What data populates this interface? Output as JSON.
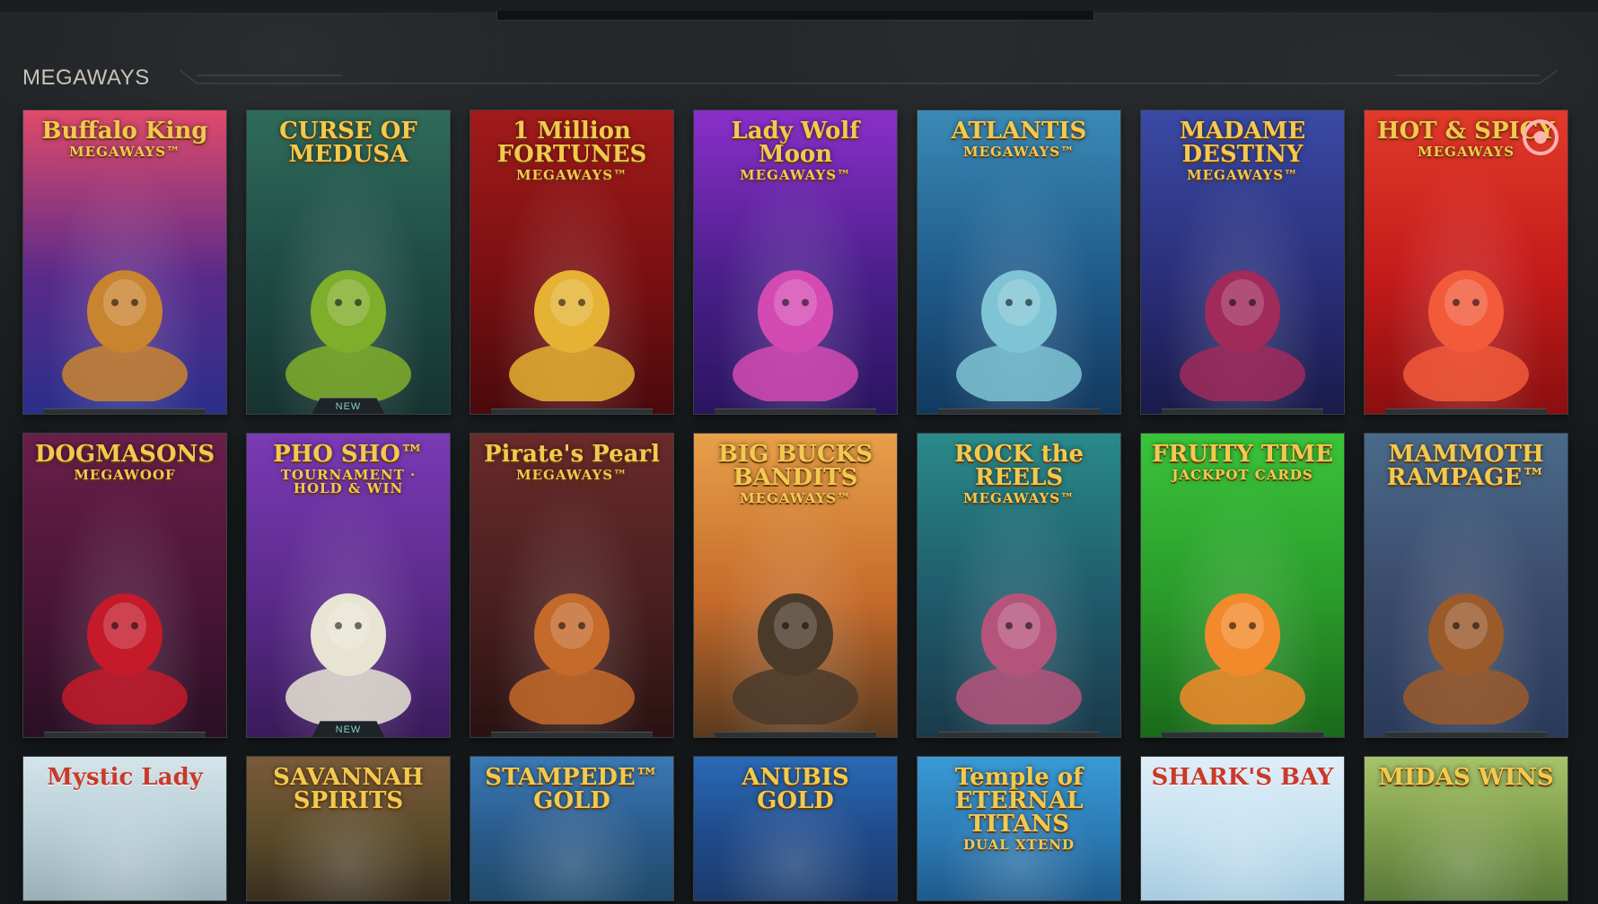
{
  "section": {
    "title": "MEGAWAYS"
  },
  "badges": {
    "new": "NEW"
  },
  "rows": [
    {
      "tiles": [
        {
          "line1": "Buffalo King",
          "line2": "MEGAWAYS™",
          "bg": [
            "#e04a6a",
            "#5a2a8a",
            "#2a2f8a"
          ],
          "art": "#c9842f",
          "name": "tile-buffalo-king-megaways"
        },
        {
          "line1": "CURSE OF MEDUSA",
          "line2": "",
          "bg": [
            "#2f6b5a",
            "#1e4a44",
            "#16332f"
          ],
          "art": "#7fae2a",
          "new": true,
          "name": "tile-curse-of-medusa"
        },
        {
          "line1": "1 Million FORTUNES",
          "line2": "MEGAWAYS™",
          "bg": [
            "#a21b1b",
            "#7a0f12",
            "#4a0a0c"
          ],
          "art": "#e5b233",
          "name": "tile-1-million-fortunes-megaways"
        },
        {
          "line1": "Lady Wolf Moon",
          "line2": "MEGAWAYS™",
          "bg": [
            "#8a2fc9",
            "#4a1f8a",
            "#2a1560"
          ],
          "art": "#d44ab3",
          "name": "tile-lady-wolf-moon-megaways"
        },
        {
          "line1": "ATLANTIS",
          "line2": "MEGAWAYS™",
          "bg": [
            "#3a8ab5",
            "#1f5a8a",
            "#123a60"
          ],
          "art": "#7fc4d4",
          "name": "tile-atlantis-megaways"
        },
        {
          "line1": "MADAME DESTINY",
          "line2": "MEGAWAYS™",
          "bg": [
            "#3a4aa5",
            "#2a2f7a",
            "#1a1a4a"
          ],
          "art": "#a02a5a",
          "name": "tile-madame-destiny-megaways"
        },
        {
          "line1": "HOT & SPICY",
          "line2": "MEGAWAYS",
          "bg": [
            "#e23a2a",
            "#c41a1a",
            "#8a0f0f"
          ],
          "art": "#f25a3a",
          "name": "tile-hot-and-spicy-megaways",
          "target": true
        }
      ]
    },
    {
      "tiles": [
        {
          "line1": "DOGMASONS",
          "line2": "MEGAWOOF",
          "bg": [
            "#6a1f4a",
            "#4a1536",
            "#2a0f24"
          ],
          "art": "#c41a2a",
          "name": "tile-dogmasons-megawoof"
        },
        {
          "line1": "PHO SHO™",
          "line2": "TOURNAMENT · HOLD & WIN",
          "bg": [
            "#7a3ab5",
            "#5a2a8a",
            "#3a1a5a"
          ],
          "art": "#e8e4d4",
          "new": true,
          "name": "tile-pho-sho"
        },
        {
          "line1": "Pirate's Pearl",
          "line2": "MEGAWAYS™",
          "bg": [
            "#6a2a2a",
            "#4a1f1f",
            "#2a1212"
          ],
          "art": "#c46a2a",
          "name": "tile-pirates-pearl-megaways"
        },
        {
          "line1": "BIG BUCKS BANDITS",
          "line2": "MEGAWAYS™",
          "bg": [
            "#e8a04a",
            "#c46a2a",
            "#5a3a1f"
          ],
          "art": "#4a3a2a",
          "name": "tile-big-bucks-bandits-megaways"
        },
        {
          "line1": "ROCK the REELS",
          "line2": "MEGAWAYS™",
          "bg": [
            "#2a8a8a",
            "#1f5a6a",
            "#1a3a4a"
          ],
          "art": "#b5547a",
          "name": "tile-rock-the-reels-megaways"
        },
        {
          "line1": "FRUITY TIME",
          "line2": "JACKPOT CARDS",
          "bg": [
            "#3ac43a",
            "#2a9a2a",
            "#1a6a1a"
          ],
          "art": "#f2892a",
          "name": "tile-fruity-time"
        },
        {
          "line1": "MAMMOTH RAMPAGE™",
          "line2": "",
          "bg": [
            "#4a6a8a",
            "#3a4a6a",
            "#2a3a5a"
          ],
          "art": "#9a5a2a",
          "name": "tile-mammoth-rampage"
        }
      ]
    },
    {
      "tiles": [
        {
          "line1": "Mystic Lady",
          "line2": "",
          "bg": [
            "#d4e4ea",
            "#b5ccd4",
            "#9ab0b8"
          ],
          "art": "#e8b46a",
          "name": "tile-mystic-lady"
        },
        {
          "line1": "SAVANNAH SPIRITS",
          "line2": "",
          "bg": [
            "#7a5a3a",
            "#5a4a2a",
            "#3a2f1f"
          ],
          "art": "#c48a3a",
          "name": "tile-savannah-spirits"
        },
        {
          "line1": "STAMPEDE™ GOLD",
          "line2": "",
          "bg": [
            "#3a7ab5",
            "#2a5a8a",
            "#1f4a6a"
          ],
          "art": "#8a5a2a",
          "name": "tile-stampede-gold"
        },
        {
          "line1": "ANUBIS GOLD",
          "line2": "",
          "bg": [
            "#2a6ab5",
            "#1f4a8a",
            "#1a3a6a"
          ],
          "art": "#e5b233",
          "name": "tile-anubis-gold"
        },
        {
          "line1": "Temple of ETERNAL TITANS",
          "line2": "DUAL XTEND",
          "bg": [
            "#3a9ad4",
            "#2a7ab5",
            "#1f5a8a"
          ],
          "art": "#c4a45a",
          "name": "tile-temple-of-eternal-titans"
        },
        {
          "line1": "SHARK'S BAY",
          "line2": "",
          "bg": [
            "#dfeef8",
            "#c4e0f0",
            "#a8cce0"
          ],
          "art": "#f2c43a",
          "name": "tile-sharks-bay"
        },
        {
          "line1": "MIDAS WINS",
          "line2": "",
          "bg": [
            "#a8c46a",
            "#7a9a4a",
            "#5a7a3a"
          ],
          "art": "#e5b233",
          "name": "tile-midas-wins"
        }
      ]
    }
  ]
}
